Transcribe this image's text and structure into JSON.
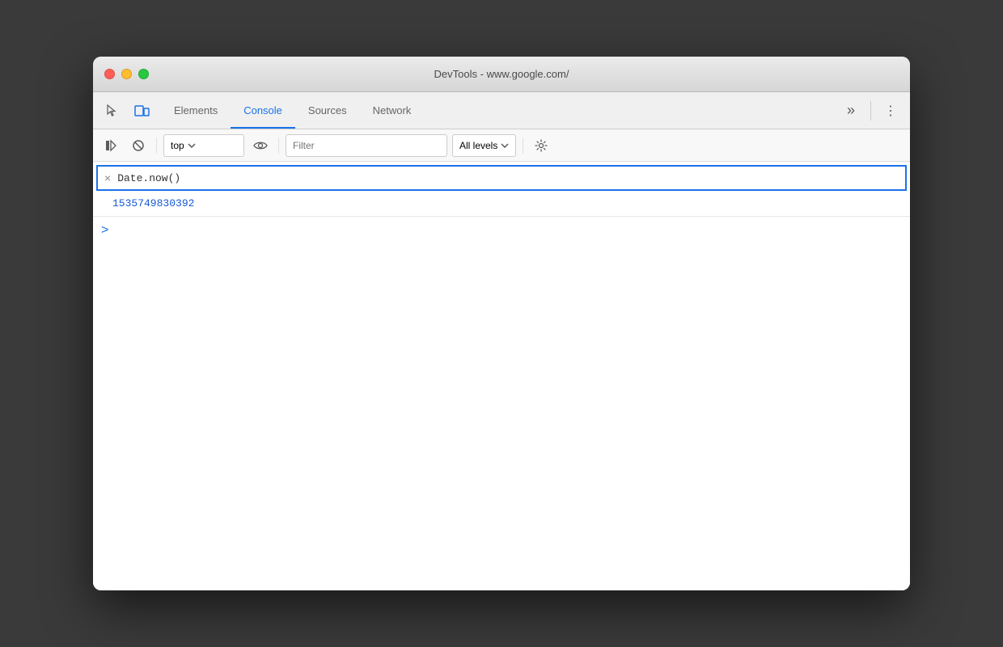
{
  "window": {
    "title": "DevTools - www.google.com/"
  },
  "toolbar": {
    "tabs": [
      {
        "id": "elements",
        "label": "Elements",
        "active": false
      },
      {
        "id": "console",
        "label": "Console",
        "active": true
      },
      {
        "id": "sources",
        "label": "Sources",
        "active": false
      },
      {
        "id": "network",
        "label": "Network",
        "active": false
      }
    ],
    "more_label": "»",
    "kebab_label": "⋮"
  },
  "console_toolbar": {
    "context_value": "top",
    "filter_placeholder": "Filter",
    "log_level_label": "All levels"
  },
  "console": {
    "command_text": "Date.now()",
    "result_value": "1535749830392",
    "close_symbol": "×",
    "chevron_symbol": ">"
  },
  "colors": {
    "active_tab": "#1a73e8",
    "result_blue": "#1558d6",
    "close_red": "#ff5f57",
    "minimize_yellow": "#febc2e",
    "maximize_green": "#28c840"
  }
}
